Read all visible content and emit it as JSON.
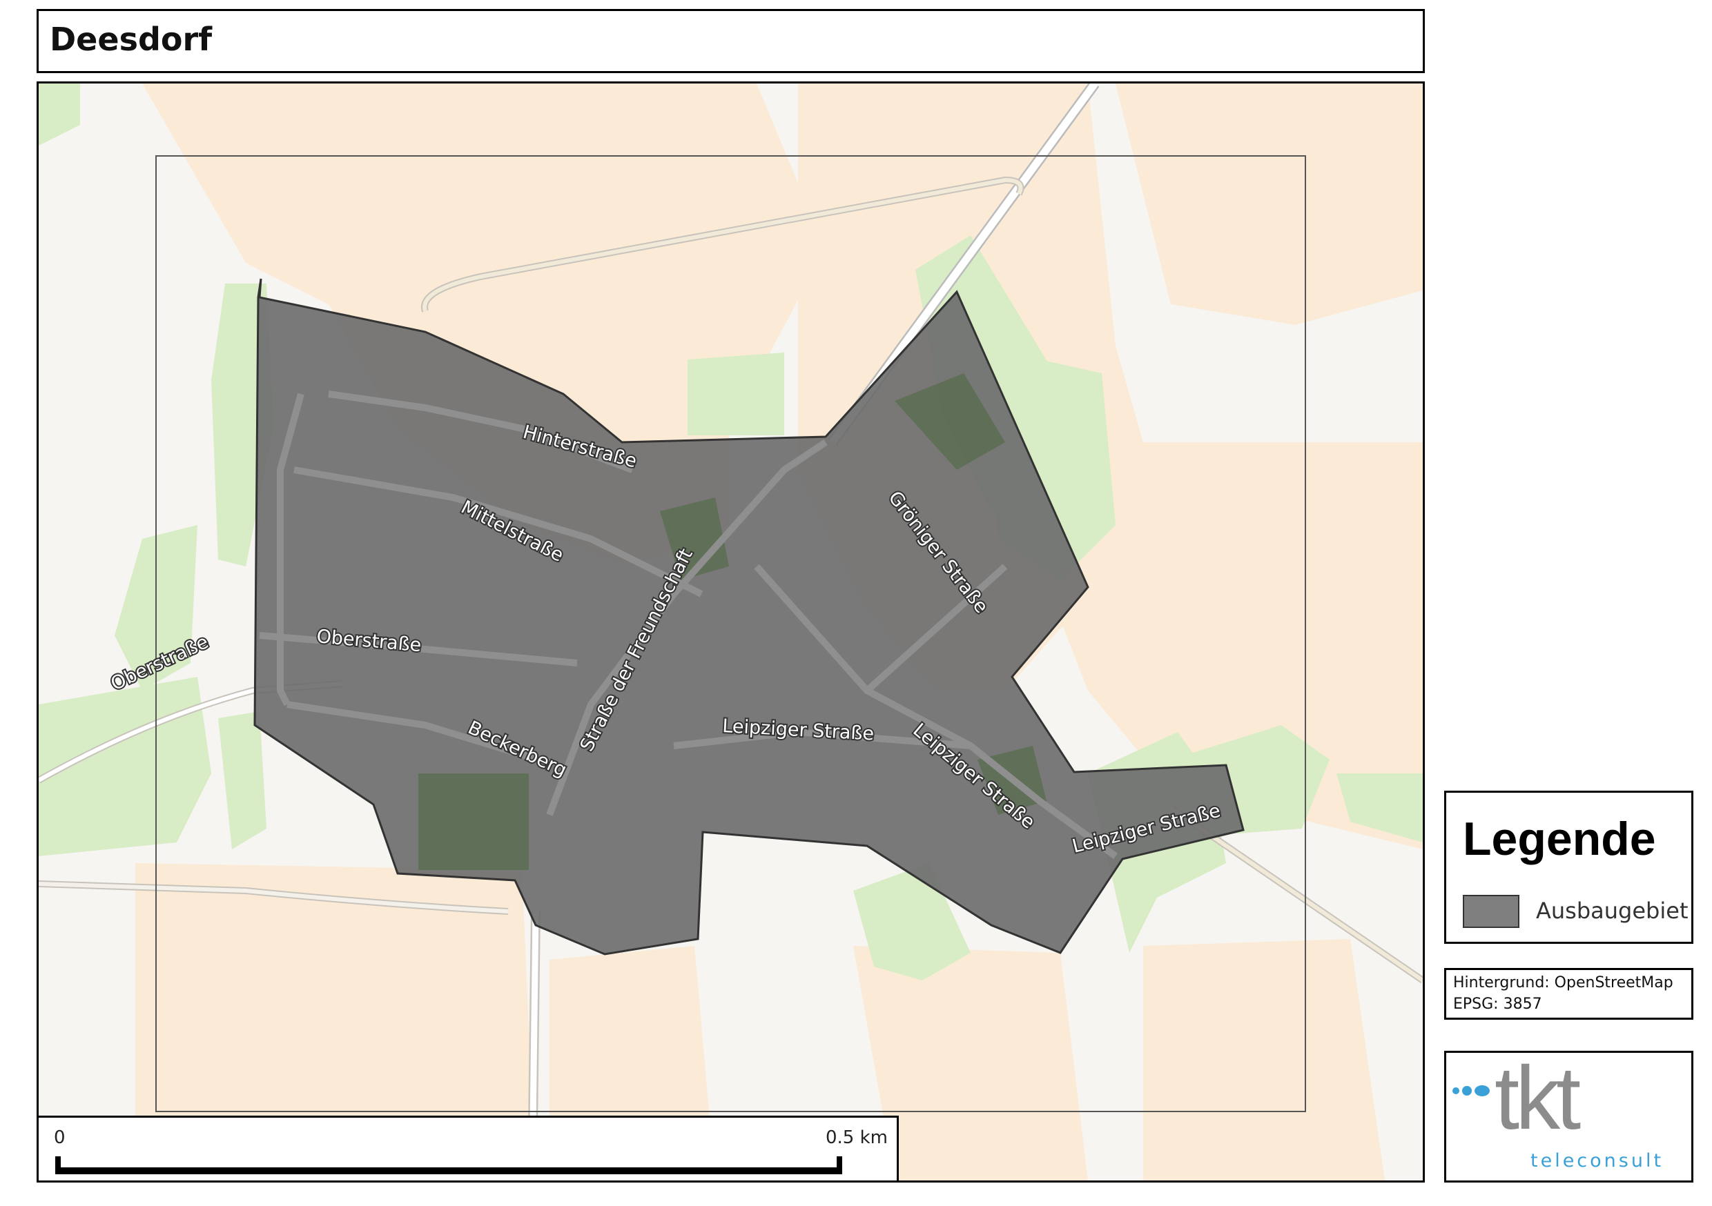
{
  "title": "Deesdorf",
  "scale_bar": {
    "start_label": "0",
    "end_label": "0.5 km"
  },
  "legend": {
    "title": "Legende",
    "items": [
      {
        "label": "Ausbaugebiet",
        "color": "#7f7f7f"
      }
    ]
  },
  "credits": {
    "background": "Hintergrund: OpenStreetMap",
    "epsg": "EPSG: 3857"
  },
  "logo": {
    "mark": "tkt",
    "subtitle": "teleconsult",
    "accent_color": "#3aa0d8",
    "mark_color": "#8c8c8c"
  },
  "streets": {
    "hinterstrasse": "Hinterstraße",
    "mittelstrasse": "Mittelstraße",
    "oberstrasse_west": "Oberstraße",
    "oberstrasse": "Oberstraße",
    "beckerberg": "Beckerberg",
    "strasse_der_freundschaft": "Straße der Freundschaft",
    "leipziger_strasse_1": "Leipziger Straße",
    "leipziger_strasse_2": "Leipziger Straße",
    "leipziger_strasse_3": "Leipziger Straße",
    "groeniger_strasse": "Gröniger Straße"
  },
  "map_colors": {
    "farmland": "#fbebd6",
    "meadow": "#d8ecc6",
    "area_fill": "#6b6b6b",
    "area_border": "#333333"
  }
}
